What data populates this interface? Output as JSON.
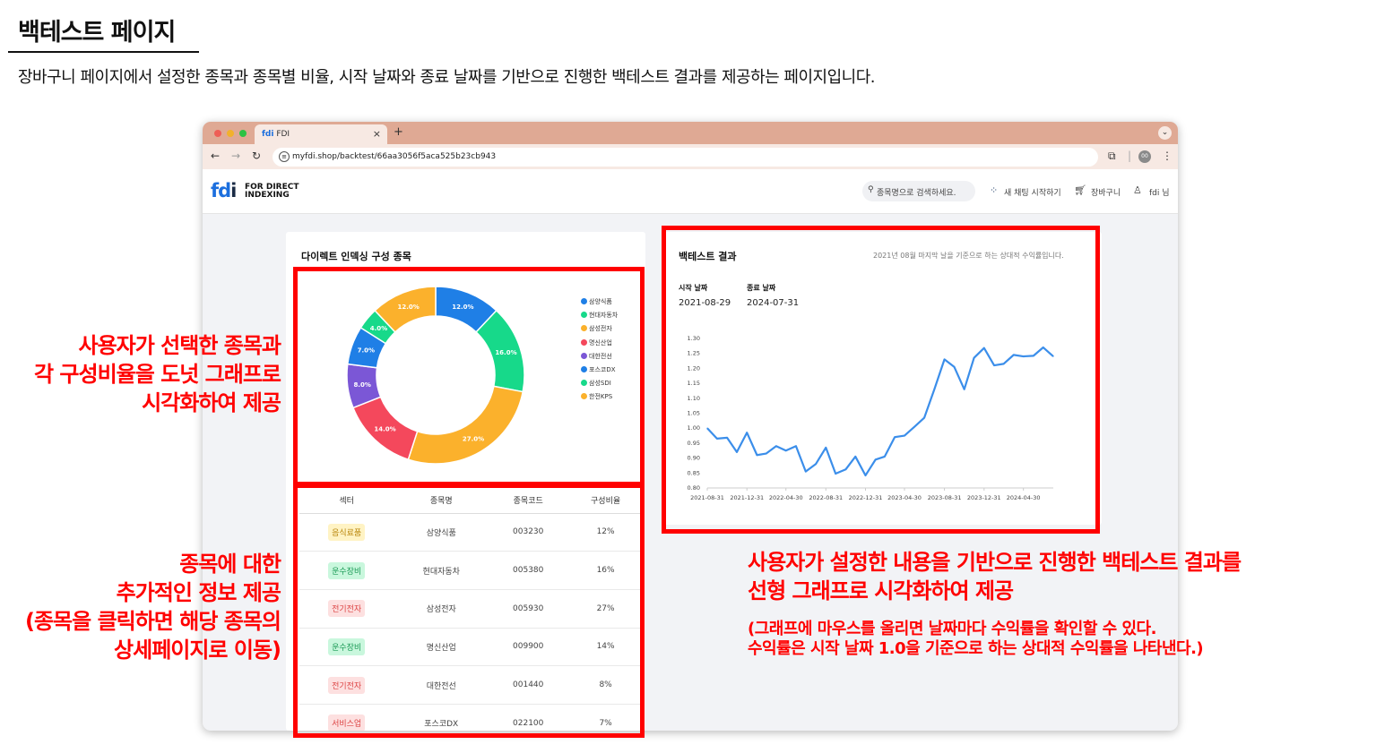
{
  "doc": {
    "title": "백테스트 페이지",
    "description": "장바구니 페이지에서 설정한 종목과 종목별 비율, 시작 날짜와 종료 날짜를 기반으로 진행한 백테스트 결과를 제공하는 페이지입니다."
  },
  "browser": {
    "tab_title": "FDI",
    "tab_close": "×",
    "new_tab": "+",
    "url": "myfdi.shop/backtest/66aa3056f5aca525b23cb943",
    "profile_label": "00"
  },
  "header": {
    "logo_mark": "fd",
    "logo_mark_i": "i",
    "logo_line1": "FOR DIRECT",
    "logo_line2": "INDEXING",
    "search_placeholder": "종목명으로 검색하세요.",
    "chat_label": "새 채팅 시작하기",
    "cart_label": "장바구니",
    "user_label": "fdi 님"
  },
  "composition": {
    "title": "다이렉트 인덱싱 구성 종목",
    "table_headers": [
      "섹터",
      "종목명",
      "종목코드",
      "구성비율"
    ],
    "rows": [
      {
        "sector": "음식료품",
        "name": "삼양식품",
        "code": "003230",
        "ratio": "12%"
      },
      {
        "sector": "운수장비",
        "name": "현대자동차",
        "code": "005380",
        "ratio": "16%"
      },
      {
        "sector": "전기전자",
        "name": "삼성전자",
        "code": "005930",
        "ratio": "27%"
      },
      {
        "sector": "운수장비",
        "name": "명신산업",
        "code": "009900",
        "ratio": "14%"
      },
      {
        "sector": "전기전자",
        "name": "대한전선",
        "code": "001440",
        "ratio": "8%"
      },
      {
        "sector": "서비스업",
        "name": "포스코DX",
        "code": "022100",
        "ratio": "7%"
      }
    ],
    "sector_colors": {
      "음식료품": {
        "bg": "#fff3c4",
        "fg": "#b8860b"
      },
      "운수장비": {
        "bg": "#c9f7dd",
        "fg": "#1a9a55"
      },
      "전기전자": {
        "bg": "#fde0e0",
        "fg": "#d44"
      },
      "서비스업": {
        "bg": "#fde0e0",
        "fg": "#d44"
      }
    }
  },
  "chart_data": [
    {
      "type": "pie",
      "donut": true,
      "labels": [
        "삼양식품",
        "현대자동차",
        "삼성전자",
        "명신산업",
        "대한전선",
        "포스코DX",
        "삼성SDI",
        "한전KPS"
      ],
      "values": [
        12.0,
        16.0,
        27.0,
        14.0,
        8.0,
        7.0,
        4.0,
        12.0
      ],
      "data_labels": [
        "12.0%",
        "16.0%",
        "27.0%",
        "14.0%",
        "8.0%",
        "7.0%",
        "4.0%",
        "12.0%"
      ],
      "colors": [
        "#1f7fe6",
        "#17d98a",
        "#fbb12c",
        "#f4485c",
        "#7b57d6",
        "#1f7fe6",
        "#17d98a",
        "#fbb12c"
      ],
      "legend": "right"
    },
    {
      "type": "line",
      "title": "백테스트 결과",
      "subtitle": "2021년 08월 마지막 날을 기준으로 하는 상대적 수익률입니다.",
      "x_ticks": [
        "2021-08-31",
        "2021-12-31",
        "2022-04-30",
        "2022-08-31",
        "2022-12-31",
        "2023-04-30",
        "2023-08-31",
        "2023-12-31",
        "2024-04-30"
      ],
      "ylim": [
        0.8,
        1.3
      ],
      "y_ticks": [
        "0.80",
        "0.85",
        "0.90",
        "0.95",
        "1.00",
        "1.05",
        "1.10",
        "1.15",
        "1.20",
        "1.25",
        "1.30"
      ],
      "x": [
        "2021-08-31",
        "2021-09-30",
        "2021-10-31",
        "2021-11-30",
        "2021-12-31",
        "2022-01-31",
        "2022-02-28",
        "2022-03-31",
        "2022-04-30",
        "2022-05-31",
        "2022-06-30",
        "2022-07-31",
        "2022-08-31",
        "2022-09-30",
        "2022-10-31",
        "2022-11-30",
        "2022-12-31",
        "2023-01-31",
        "2023-02-28",
        "2023-03-31",
        "2023-04-30",
        "2023-05-31",
        "2023-06-30",
        "2023-07-31",
        "2023-08-31",
        "2023-09-30",
        "2023-10-31",
        "2023-11-30",
        "2023-12-31",
        "2024-01-31",
        "2024-02-29",
        "2024-03-31",
        "2024-04-30",
        "2024-05-31",
        "2024-06-30",
        "2024-07-31"
      ],
      "series": [
        {
          "values": [
            1.0,
            0.965,
            0.968,
            0.92,
            0.985,
            0.91,
            0.915,
            0.94,
            0.925,
            0.94,
            0.855,
            0.88,
            0.935,
            0.848,
            0.862,
            0.905,
            0.842,
            0.895,
            0.905,
            0.97,
            0.975,
            1.005,
            1.035,
            1.13,
            1.23,
            1.205,
            1.13,
            1.235,
            1.268,
            1.21,
            1.215,
            1.245,
            1.24,
            1.242,
            1.27,
            1.24
          ],
          "color": "#3b8eea"
        }
      ],
      "grid": false
    }
  ],
  "backtest": {
    "start_label": "시작 날짜",
    "end_label": "종료 날짜",
    "start_date": "2021-08-29",
    "end_date": "2024-07-31"
  },
  "annotations": {
    "donut_note": [
      "사용자가 선택한 종목과",
      "각 구성비율을 도넛 그래프로",
      "시각화하여 제공"
    ],
    "table_note": [
      "종목에 대한",
      "추가적인 정보 제공",
      "(종목을 클릭하면 해당 종목의",
      "상세페이지로 이동)"
    ],
    "chart_note": [
      "사용자가 설정한 내용을 기반으로 진행한 백테스트 결과를",
      "선형 그래프로 시각화하여 제공"
    ],
    "chart_subnote": [
      "(그래프에 마우스를 올리면 날짜마다 수익률을 확인할 수 있다.",
      "수익률은 시작 날짜 1.0을 기준으로 하는 상대적 수익률을 나타낸다.)"
    ]
  },
  "colors": {
    "annotation_red": "#ff0000",
    "accent_blue": "#1f7fe6",
    "tabbar": "#dfa994"
  }
}
